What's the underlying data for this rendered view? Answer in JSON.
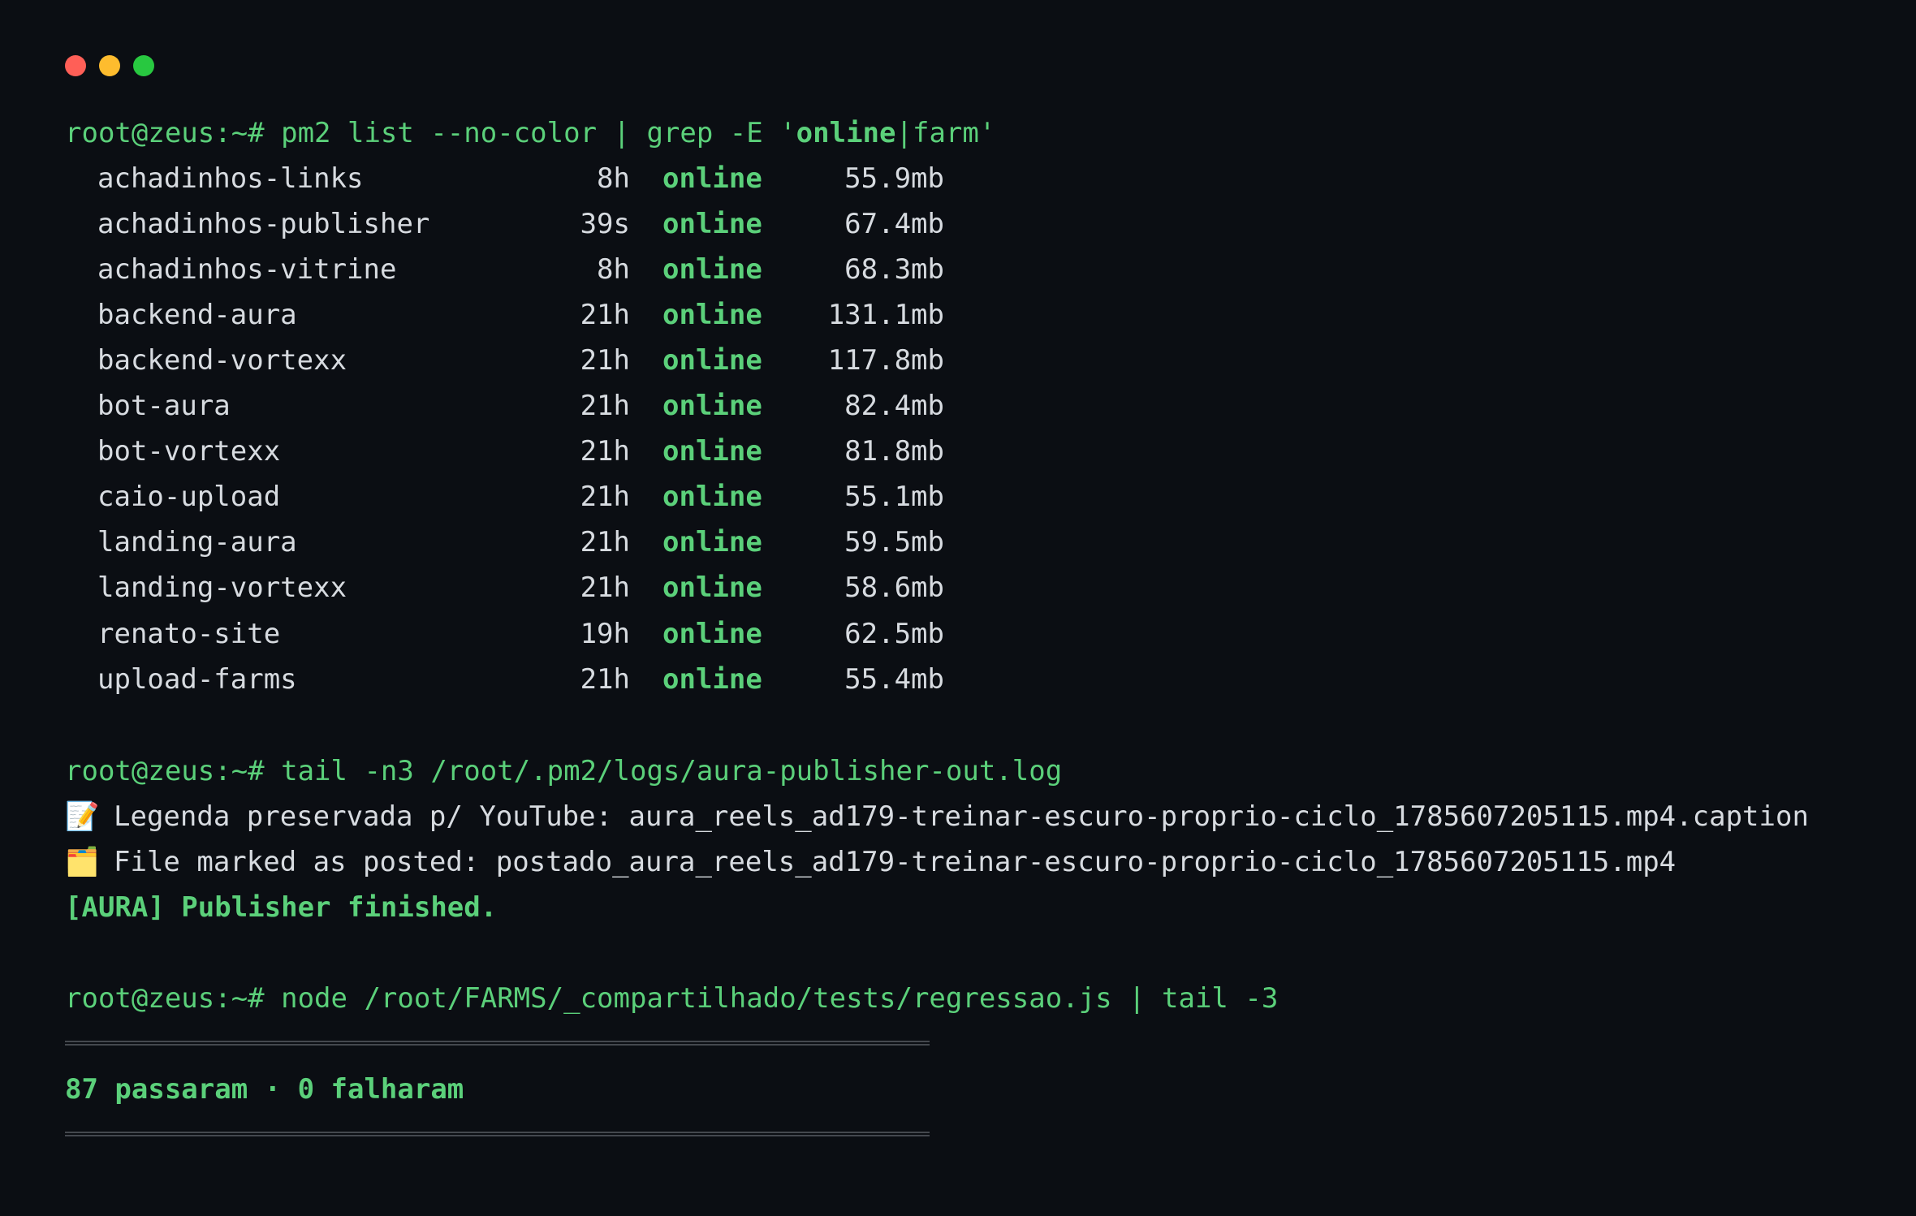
{
  "window": {
    "controls": [
      "close",
      "minimize",
      "maximize"
    ],
    "colors": {
      "close": "#ff5f57",
      "minimize": "#febc2e",
      "maximize": "#28c840"
    }
  },
  "commands": [
    {
      "prompt": "root@zeus:~#",
      "text_parts": [
        " pm2 list --no-color | grep -E '",
        "online",
        "|farm'"
      ]
    },
    {
      "prompt": "root@zeus:~#",
      "text": " tail -n3 /root/.pm2/logs/aura-publisher-out.log"
    },
    {
      "prompt": "root@zeus:~#",
      "text": " node /root/FARMS/_compartilhado/tests/regressao.js | tail -3"
    }
  ],
  "processes": [
    {
      "name": "achadinhos-links",
      "uptime": "8h",
      "status": "online",
      "memory": "55.9mb"
    },
    {
      "name": "achadinhos-publisher",
      "uptime": "39s",
      "status": "online",
      "memory": "67.4mb"
    },
    {
      "name": "achadinhos-vitrine",
      "uptime": "8h",
      "status": "online",
      "memory": "68.3mb"
    },
    {
      "name": "backend-aura",
      "uptime": "21h",
      "status": "online",
      "memory": "131.1mb"
    },
    {
      "name": "backend-vortexx",
      "uptime": "21h",
      "status": "online",
      "memory": "117.8mb"
    },
    {
      "name": "bot-aura",
      "uptime": "21h",
      "status": "online",
      "memory": "82.4mb"
    },
    {
      "name": "bot-vortexx",
      "uptime": "21h",
      "status": "online",
      "memory": "81.8mb"
    },
    {
      "name": "caio-upload",
      "uptime": "21h",
      "status": "online",
      "memory": "55.1mb"
    },
    {
      "name": "landing-aura",
      "uptime": "21h",
      "status": "online",
      "memory": "59.5mb"
    },
    {
      "name": "landing-vortexx",
      "uptime": "21h",
      "status": "online",
      "memory": "58.6mb"
    },
    {
      "name": "renato-site",
      "uptime": "19h",
      "status": "online",
      "memory": "62.5mb"
    },
    {
      "name": "upload-farms",
      "uptime": "21h",
      "status": "online",
      "memory": "55.4mb"
    }
  ],
  "log_lines": [
    {
      "icon": "📝",
      "icon_name": "memo-icon",
      "text": "Legenda preservada p/ YouTube: aura_reels_ad179-treinar-escuro-proprio-ciclo_1785607205115.mp4.caption"
    },
    {
      "icon": "🗂️",
      "icon_name": "card-index-dividers-icon",
      "text": "File marked as posted: postado_aura_reels_ad179-treinar-escuro-proprio-ciclo_1785607205115.mp4"
    }
  ],
  "publisher_status": "[AURA] Publisher finished.",
  "test_summary": "87 passaram · 0 falharam",
  "theme": {
    "background": "#0b0e13",
    "text": "#d7dbe0",
    "accent_green": "#5bd07a"
  }
}
